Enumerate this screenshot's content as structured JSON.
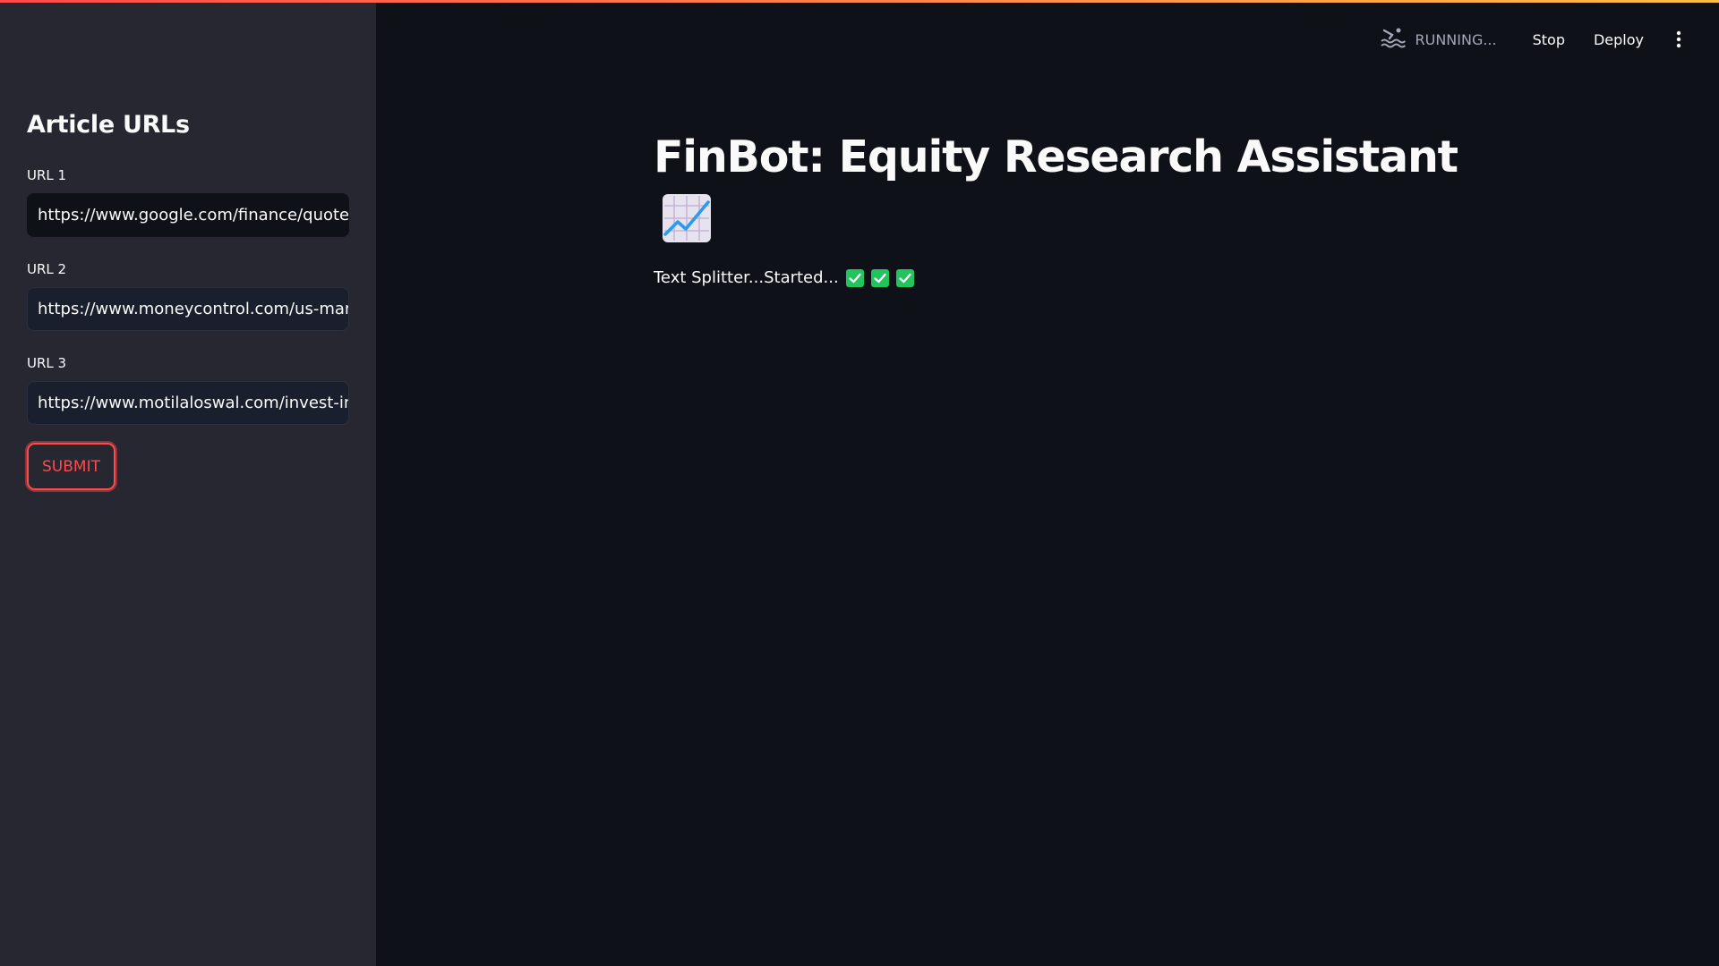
{
  "sidebar": {
    "title": "Article URLs",
    "fields": [
      {
        "label": "URL 1",
        "value": "https://www.google.com/finance/quote/"
      },
      {
        "label": "URL 2",
        "value": "https://www.moneycontrol.com/us-marl"
      },
      {
        "label": "URL 3",
        "value": "https://www.motilaloswal.com/invest-in"
      }
    ],
    "submit_label": "SUBMIT"
  },
  "toolbar": {
    "status": "RUNNING...",
    "stop_label": "Stop",
    "deploy_label": "Deploy",
    "status_icon": "swimmer-icon",
    "menu_icon": "kebab-menu-icon"
  },
  "main": {
    "title": "FinBot: Equity Research Assistant",
    "title_icon": "chart-increasing-emoji",
    "status_text": "Text Splitter...Started..."
  },
  "colors": {
    "accent": "#ff4b4b",
    "background": "#0e1117",
    "sidebar": "#262730",
    "check": "#21c45d"
  }
}
